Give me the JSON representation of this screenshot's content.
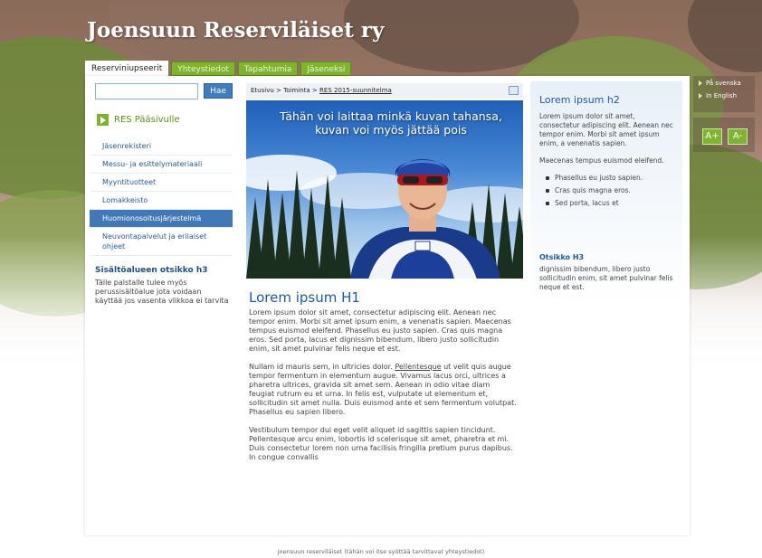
{
  "site": {
    "title": "Joensuun Reserviläiset ry"
  },
  "tabs": [
    "Reserviniupseerit",
    "Yhteystiedot",
    "Tapahtumia",
    "Jäseneksi"
  ],
  "search": {
    "placeholder": "",
    "button": "Hae"
  },
  "sidebar": {
    "heading": "RES Pääsivulle",
    "items": [
      "Jäsenrekisteri",
      "Messu- ja esittelymateriaali",
      "Myyntituotteet",
      "Lomakkeisto",
      "Huomionosoitusjärjestelmä",
      "Neuvontapalvelut ja erilaiset ohjeet"
    ],
    "active_index": 4,
    "h3": "Sisältöalueen otsikko h3",
    "text": "Tälle palstalle tulee myös perussisältöalue jota voidaan käyttää jos vasenta vlikkoa ei tarvita"
  },
  "breadcrumb": {
    "home": "Etusivu",
    "sep": ">",
    "level2": "Toiminta",
    "current": "RES 2015-suunnitelma"
  },
  "hero": {
    "caption": "Tähän voi laittaa minkä kuvan tahansa, kuvan voi myös jättää pois"
  },
  "main": {
    "h1": "Lorem ipsum H1",
    "p1": "Lorem ipsum dolor sit amet, consectetur adipiscing elit. Aenean nec tempor enim. Morbi sit amet ipsum enim, a venenatis sapien. Maecenas tempus euismod eleifend. Phasellus eu justo sapien. Cras quis magna eros. Sed porta, lacus et dignissim bibendum, libero justo sollicitudin enim, sit amet pulvinar felis neque et est.",
    "p2_a": "Nullam id mauris sem, in ultricies dolor.",
    "p2_link": "Pellentesque",
    "p2_b": "ut velit quis augue tempor fermentum in elementum augue. Vivamus lacus orci, ultrices a pharetra ultrices, gravida sit amet sem. Aenean in odio vitae diam feugiat rutrum eu et urna. In felis est, vulputate ut elementum et, sollicitudin sit amet nulla. Duis euismod ante et sem fermentum volutpat. Phasellus eu sapien libero.",
    "p3": "Vestibulum tempor dui eget velit aliquet id sagittis sapien tincidunt. Pellentesque arcu enim, lobortis id scelerisque sit amet, pharetra et mi. Duis consectetur lorem non urna facilisis fringilla pretium purus dapibus. In congue convallis"
  },
  "right": {
    "h2": "Lorem ipsum h2",
    "p1": "Lorem ipsum dolor sit amet, consectetur adipiscing elit. Aenean nec tempor enim. Morbi sit amet ipsum enim, a venenatis sapien.",
    "p2": "Maecenas tempus euismod eleifend.",
    "bullets": [
      "Phasellus eu justo sapien.",
      "Cras quis magna eros.",
      "Sed porta, lacus et"
    ],
    "h3": "Otsikko H3",
    "p3": "dignissim bibendum, libero justo sollicitudin enim, sit amet pulvinar felis neque et est."
  },
  "lang": [
    "På svenska",
    "In English"
  ],
  "font_controls": {
    "increase": "A+",
    "decrease": "A-"
  },
  "footer": "Joensuun reserviläiset (tähän voi itse syöttää tarvittavat yhteystiedot)",
  "colors": {
    "accent_green": "#7fb431",
    "link_blue": "#1f5aa8",
    "nav_active": "#4178b8"
  }
}
